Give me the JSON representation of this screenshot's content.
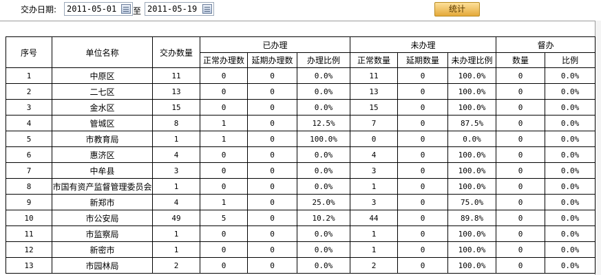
{
  "filter": {
    "label": "交办日期:",
    "start_date": "2011-05-01",
    "separator": "至",
    "end_date": "2011-05-19",
    "submit_label": "统计"
  },
  "table": {
    "headers_top": {
      "index": "序号",
      "unit": "单位名称",
      "assigned": "交办数量",
      "done_group": "已办理",
      "undone_group": "未办理",
      "supervise_group": "督办"
    },
    "headers_sub": [
      "正常办理数",
      "延期办理数",
      "办理比例",
      "正常数量",
      "延期数量",
      "未办理比例",
      "数量",
      "比例"
    ],
    "rows": [
      [
        "1",
        "中原区",
        "11",
        "0",
        "0",
        "0.0%",
        "11",
        "0",
        "100.0%",
        "0",
        "0.0%"
      ],
      [
        "2",
        "二七区",
        "13",
        "0",
        "0",
        "0.0%",
        "13",
        "0",
        "100.0%",
        "0",
        "0.0%"
      ],
      [
        "3",
        "金水区",
        "15",
        "0",
        "0",
        "0.0%",
        "15",
        "0",
        "100.0%",
        "0",
        "0.0%"
      ],
      [
        "4",
        "管城区",
        "8",
        "1",
        "0",
        "12.5%",
        "7",
        "0",
        "87.5%",
        "0",
        "0.0%"
      ],
      [
        "5",
        "市教育局",
        "1",
        "1",
        "0",
        "100.0%",
        "0",
        "0",
        "0.0%",
        "0",
        "0.0%"
      ],
      [
        "6",
        "惠济区",
        "4",
        "0",
        "0",
        "0.0%",
        "4",
        "0",
        "100.0%",
        "0",
        "0.0%"
      ],
      [
        "7",
        "中牟县",
        "3",
        "0",
        "0",
        "0.0%",
        "3",
        "0",
        "100.0%",
        "0",
        "0.0%"
      ],
      [
        "8",
        "市国有资产监督管理委员会",
        "1",
        "0",
        "0",
        "0.0%",
        "1",
        "0",
        "100.0%",
        "0",
        "0.0%"
      ],
      [
        "9",
        "新郑市",
        "4",
        "1",
        "0",
        "25.0%",
        "3",
        "0",
        "75.0%",
        "0",
        "0.0%"
      ],
      [
        "10",
        "市公安局",
        "49",
        "5",
        "0",
        "10.2%",
        "44",
        "0",
        "89.8%",
        "0",
        "0.0%"
      ],
      [
        "11",
        "市监察局",
        "1",
        "0",
        "0",
        "0.0%",
        "1",
        "0",
        "100.0%",
        "0",
        "0.0%"
      ],
      [
        "12",
        "新密市",
        "1",
        "0",
        "0",
        "0.0%",
        "1",
        "0",
        "100.0%",
        "0",
        "0.0%"
      ],
      [
        "13",
        "市园林局",
        "2",
        "0",
        "0",
        "0.0%",
        "2",
        "0",
        "100.0%",
        "0",
        "0.0%"
      ]
    ]
  }
}
